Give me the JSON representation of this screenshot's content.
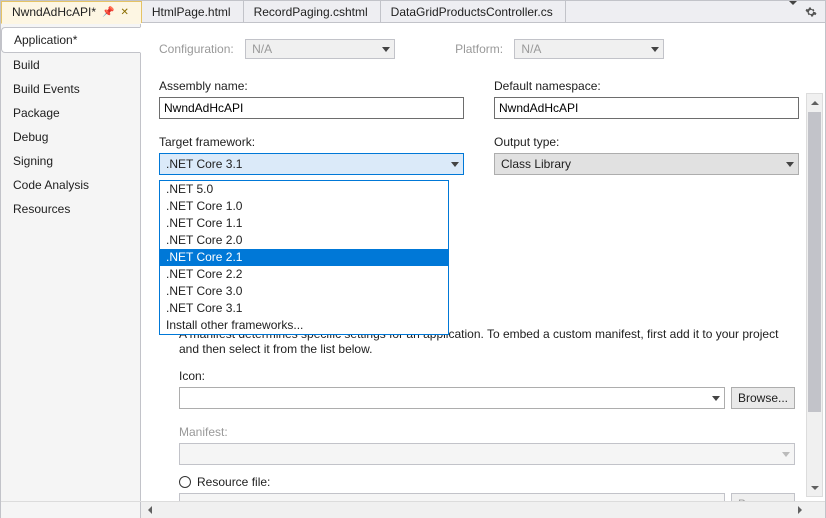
{
  "tabs": {
    "active": "NwndAdHcAPI*",
    "items": [
      "HtmlPage.html",
      "RecordPaging.cshtml",
      "DataGridProductsController.cs"
    ]
  },
  "sidebar": {
    "items": [
      "Application*",
      "Build",
      "Build Events",
      "Package",
      "Debug",
      "Signing",
      "Code Analysis",
      "Resources"
    ],
    "selected_index": 0
  },
  "top": {
    "config_label": "Configuration:",
    "config_value": "N/A",
    "platform_label": "Platform:",
    "platform_value": "N/A"
  },
  "fields": {
    "assembly_label": "Assembly name:",
    "assembly_value": "NwndAdHcAPI",
    "namespace_label": "Default namespace:",
    "namespace_value": "NwndAdHcAPI",
    "target_label": "Target framework:",
    "target_value": ".NET Core 3.1",
    "output_label": "Output type:",
    "output_value": "Class Library"
  },
  "target_dropdown": {
    "options": [
      ".NET 5.0",
      ".NET Core 1.0",
      ".NET Core 1.1",
      ".NET Core 2.0",
      ".NET Core 2.1",
      ".NET Core 2.2",
      ".NET Core 3.0",
      ".NET Core 3.1",
      "Install other frameworks..."
    ],
    "highlighted_index": 4
  },
  "manifest": {
    "description": "A manifest determines specific settings for an application. To embed a custom manifest, first add it to your project and then select it from the list below.",
    "icon_label": "Icon:",
    "browse_label": "Browse...",
    "manifest_label": "Manifest:",
    "resource_label": "Resource file:"
  },
  "glyphs": {
    "pin": "📌",
    "close": "✕"
  }
}
